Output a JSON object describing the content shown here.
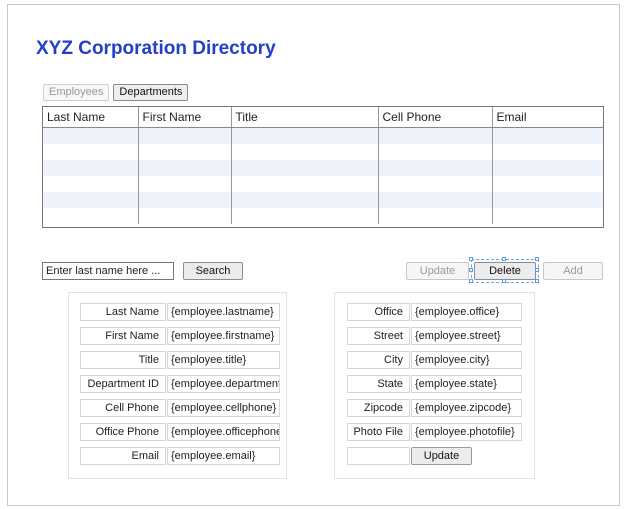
{
  "page": {
    "title": "XYZ Corporation Directory"
  },
  "tabs": [
    {
      "label": "Employees",
      "state": "disabled"
    },
    {
      "label": "Departments",
      "state": "active"
    }
  ],
  "grid": {
    "columns": [
      "Last Name",
      "First Name",
      "Title",
      "Cell Phone",
      "Email"
    ],
    "rows": [
      [
        "",
        "",
        "",
        "",
        ""
      ],
      [
        "",
        "",
        "",
        "",
        ""
      ],
      [
        "",
        "",
        "",
        "",
        ""
      ],
      [
        "",
        "",
        "",
        "",
        ""
      ],
      [
        "",
        "",
        "",
        "",
        ""
      ],
      [
        "",
        "",
        "",
        "",
        ""
      ]
    ]
  },
  "search": {
    "placeholder": "Enter last name here ...",
    "button_label": "Search"
  },
  "actions": {
    "update_label": "Update",
    "delete_label": "Delete",
    "add_label": "Add"
  },
  "employee_form": {
    "fields": [
      {
        "label": "Last Name",
        "value": "{employee.lastname}"
      },
      {
        "label": "First Name",
        "value": "{employee.firstname}"
      },
      {
        "label": "Title",
        "value": "{employee.title}"
      },
      {
        "label": "Department ID",
        "value": "{employee.departmenti"
      },
      {
        "label": "Cell Phone",
        "value": "{employee.cellphone}"
      },
      {
        "label": "Office Phone",
        "value": "{employee.officephone}"
      },
      {
        "label": "Email",
        "value": "{employee.email}"
      }
    ]
  },
  "address_form": {
    "fields": [
      {
        "label": "Office",
        "value": "{employee.office}"
      },
      {
        "label": "Street",
        "value": "{employee.street}"
      },
      {
        "label": "City",
        "value": "{employee.city}"
      },
      {
        "label": "State",
        "value": "{employee.state}"
      },
      {
        "label": "Zipcode",
        "value": "{employee.zipcode}"
      },
      {
        "label": "Photo File",
        "value": "{employee.photofile}"
      }
    ],
    "update_label": "Update"
  },
  "colors": {
    "title": "#2340c8",
    "row_alt": "#eef2fa",
    "selection": "#5aa0e0"
  }
}
